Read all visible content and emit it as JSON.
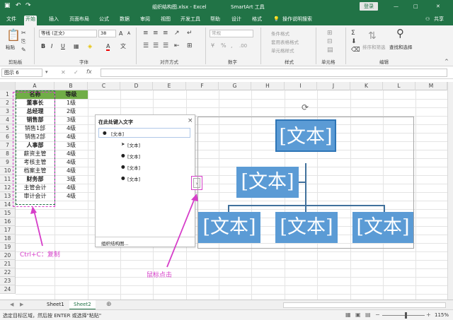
{
  "titlebar": {
    "save_icon": "save-icon",
    "undo_icon": "undo-icon",
    "redo_icon": "redo-icon",
    "title": "组织结构图.xlsx - Excel",
    "context": "SmartArt 工具",
    "login": "登录",
    "min": "—",
    "restore": "□",
    "close": "✕"
  },
  "tabs": [
    "文件",
    "开始",
    "插入",
    "页面布局",
    "公式",
    "数据",
    "审阅",
    "视图",
    "开发工具",
    "帮助",
    "设计",
    "格式"
  ],
  "active_tab": "开始",
  "search_hint": "操作说明搜索",
  "share": "共享",
  "ribbon": {
    "paste": "粘贴",
    "clipboard": "剪贴板",
    "font_name": "等线 (正文)",
    "font_size": "38",
    "bold": "B",
    "italic": "I",
    "underline": "U",
    "font_color": "A",
    "grow_font": "A",
    "shrink_font": "A",
    "font_group": "字体",
    "align_group": "对齐方式",
    "number_format": "常规",
    "number_group": "数字",
    "cond_format": "条件格式",
    "table_format": "套用表格格式",
    "cell_style": "单元格样式",
    "style_group": "样式",
    "cells_group": "单元格",
    "sort_filter": "排序和筛选",
    "find_select": "查找和选择",
    "edit_group": "编辑"
  },
  "formula": {
    "namebox": "图示 6",
    "cancel": "✕",
    "enter": "✓",
    "fx": "fx",
    "value": ""
  },
  "columns": [
    "A",
    "B",
    "C",
    "D",
    "E",
    "F",
    "G",
    "H",
    "I",
    "J",
    "K",
    "L",
    "M"
  ],
  "rows": [
    "1",
    "2",
    "3",
    "4",
    "5",
    "6",
    "7",
    "8",
    "9",
    "10",
    "11",
    "12",
    "13",
    "14",
    "15",
    "16",
    "17",
    "18",
    "19",
    "20",
    "21",
    "22",
    "23",
    "24"
  ],
  "table": {
    "header": [
      "名称",
      "等级"
    ],
    "data": [
      [
        "董事长",
        "1级"
      ],
      [
        "总经理",
        "2级"
      ],
      [
        "销售部",
        "3级"
      ],
      [
        "销售1部",
        "4级"
      ],
      [
        "销售2部",
        "4级"
      ],
      [
        "人事部",
        "3级"
      ],
      [
        "薪资主管",
        "4级"
      ],
      [
        "考核主管",
        "4级"
      ],
      [
        "档案主管",
        "4级"
      ],
      [
        "财务部",
        "3级"
      ],
      [
        "主管会计",
        "4级"
      ],
      [
        "审计会计",
        "4级"
      ]
    ],
    "bold_names": [
      "董事长",
      "总经理",
      "销售部",
      "人事部",
      "财务部"
    ]
  },
  "textpane": {
    "title": "在此处键入文字",
    "close": "×",
    "items": [
      "[文本]",
      "[文本]",
      "[文本]",
      "[文本]",
      "[文本]"
    ],
    "footer": "组织结构图..."
  },
  "smartart": {
    "node_text": "[文本]",
    "fill": "#5b9bd5",
    "line": "#41719c"
  },
  "annotations": {
    "copy": "Ctrl+C：复制",
    "click": "鼠标点击",
    "color": "#d63ec9"
  },
  "sheets": [
    "Sheet1",
    "Sheet2"
  ],
  "active_sheet": "Sheet2",
  "add_sheet": "⊕",
  "status": {
    "text": "选定目标区域，然后按 ENTER 或选择\"粘贴\"",
    "zoom": "115%"
  },
  "colors": {
    "brand": "#217346"
  }
}
